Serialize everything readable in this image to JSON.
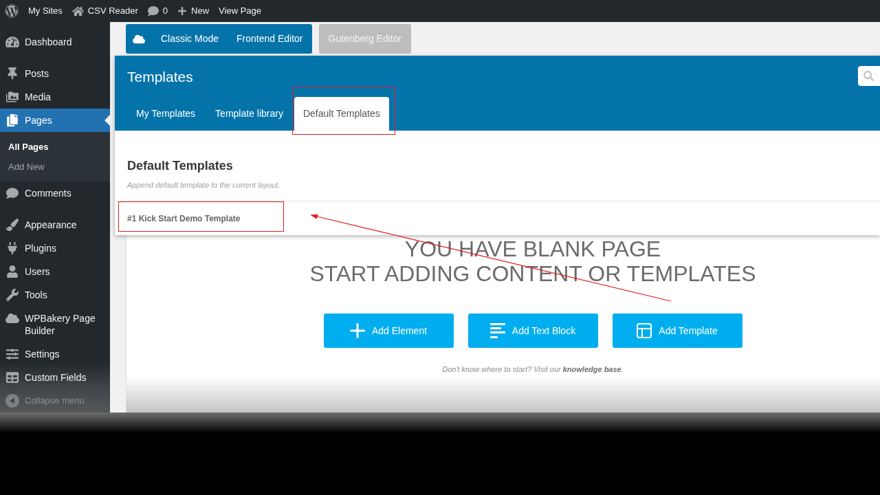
{
  "admin_bar": {
    "items": [
      {
        "kind": "logo"
      },
      {
        "kind": "link",
        "label": "My Sites"
      },
      {
        "kind": "home",
        "label": "CSV Reader"
      },
      {
        "kind": "comments",
        "label": "0"
      },
      {
        "kind": "new",
        "label": "New"
      },
      {
        "kind": "link",
        "label": "View Page"
      }
    ]
  },
  "sidebar": {
    "groups": [
      {
        "items": [
          {
            "label": "Dashboard",
            "selected": false
          }
        ]
      },
      {
        "items": [
          {
            "label": "Posts",
            "selected": false
          },
          {
            "label": "Media",
            "selected": false
          },
          {
            "label": "Pages",
            "selected": true,
            "children": [
              {
                "label": "All Pages",
                "selected": true
              },
              {
                "label": "Add New",
                "selected": false
              }
            ]
          },
          {
            "label": "Comments",
            "selected": false
          }
        ]
      },
      {
        "items": [
          {
            "label": "Appearance",
            "selected": false
          },
          {
            "label": "Plugins",
            "selected": false
          },
          {
            "label": "Users",
            "selected": false
          },
          {
            "label": "Tools",
            "selected": false
          },
          {
            "label": "WPBakery Page Builder",
            "selected": false
          },
          {
            "label": "Settings",
            "selected": false
          },
          {
            "label": "Custom Fields",
            "selected": false
          }
        ]
      }
    ],
    "collapse": {
      "label": "Collapse menu"
    }
  },
  "editor_toolbar": {
    "modes": [
      {
        "label": "Classic Mode"
      },
      {
        "label": "Frontend Editor"
      }
    ],
    "gutenberg": {
      "label": "Gutenberg Editor"
    }
  },
  "templates_panel": {
    "title": "Templates",
    "tabs": [
      {
        "label": "My Templates",
        "selected": false,
        "highlighted": false
      },
      {
        "label": "Template library",
        "selected": false,
        "highlighted": false
      },
      {
        "label": "Default Templates",
        "selected": true,
        "highlighted": true
      }
    ],
    "section": {
      "heading": "Default Templates",
      "description": "Append default template to the current layout.",
      "templates": [
        {
          "name": "#1 Kick Start Demo Template",
          "highlighted": true
        }
      ]
    }
  },
  "blank_page": {
    "headline": [
      "YOU HAVE BLANK PAGE",
      "START ADDING CONTENT OR TEMPLATES"
    ],
    "buttons": [
      {
        "kind": "element",
        "label": "Add Element"
      },
      {
        "kind": "text",
        "label": "Add Text Block"
      },
      {
        "kind": "template",
        "label": "Add Template"
      }
    ],
    "help": "Don't know where to start? Visit our **knowledge base**."
  }
}
